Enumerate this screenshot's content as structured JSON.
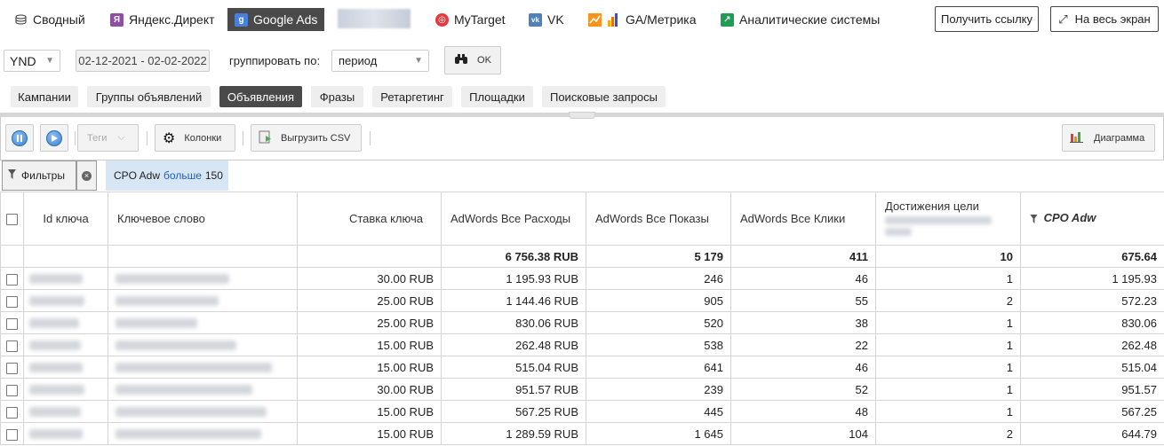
{
  "nav": {
    "items": [
      {
        "label": "Сводный",
        "icon": "coins-icon"
      },
      {
        "label": "Яндекс.Директ",
        "icon": "yandex-icon"
      },
      {
        "label": "Google Ads",
        "icon": "google-icon"
      },
      {
        "label": "MyTarget",
        "icon": "mytarget-icon"
      },
      {
        "label": "VK",
        "icon": "vk-icon"
      },
      {
        "label": "GA/Метрика",
        "icon": "analytics-icon"
      },
      {
        "label": "Аналитические системы",
        "icon": "analytics-systems-icon"
      }
    ],
    "get_link": "Получить ссылку",
    "fullscreen": "На весь экран"
  },
  "filters": {
    "currency": "YND",
    "date_range": "02-12-2021 - 02-02-2022",
    "group_by_label": "группировать по:",
    "group_by_value": "период",
    "ok": "OK"
  },
  "tabs": [
    "Кампании",
    "Группы объявлений",
    "Объявления",
    "Фразы",
    "Ретаргетинг",
    "Площадки",
    "Поисковые запросы"
  ],
  "toolbar": {
    "tags": "Теги",
    "columns": "Колонки",
    "export": "Выгрузить CSV",
    "chart": "Диаграмма"
  },
  "filterbar": {
    "filters_label": "Фильтры",
    "chip_metric": "CPO Adw",
    "chip_op": "больше",
    "chip_value": "150"
  },
  "table": {
    "headers": {
      "id": "Id ключа",
      "keyword": "Ключевое слово",
      "bid": "Ставка ключа",
      "spend": "AdWords Все Расходы",
      "impressions": "AdWords Все Показы",
      "clicks": "AdWords Все Клики",
      "goals": "Достижения цели",
      "cpo": "CPO Adw"
    },
    "totals": {
      "spend": "6 756.38 RUB",
      "impressions": "5 179",
      "clicks": "411",
      "goals": "10",
      "cpo": "675.64"
    },
    "rows": [
      {
        "bid": "30.00 RUB",
        "spend": "1 195.93 RUB",
        "impressions": "246",
        "clicks": "46",
        "goals": "1",
        "cpo": "1 195.93"
      },
      {
        "bid": "25.00 RUB",
        "spend": "1 144.46 RUB",
        "impressions": "905",
        "clicks": "55",
        "goals": "2",
        "cpo": "572.23"
      },
      {
        "bid": "25.00 RUB",
        "spend": "830.06 RUB",
        "impressions": "520",
        "clicks": "38",
        "goals": "1",
        "cpo": "830.06"
      },
      {
        "bid": "15.00 RUB",
        "spend": "262.48 RUB",
        "impressions": "538",
        "clicks": "22",
        "goals": "1",
        "cpo": "262.48"
      },
      {
        "bid": "15.00 RUB",
        "spend": "515.04 RUB",
        "impressions": "641",
        "clicks": "46",
        "goals": "1",
        "cpo": "515.04"
      },
      {
        "bid": "30.00 RUB",
        "spend": "951.57 RUB",
        "impressions": "239",
        "clicks": "52",
        "goals": "1",
        "cpo": "951.57"
      },
      {
        "bid": "15.00 RUB",
        "spend": "567.25 RUB",
        "impressions": "445",
        "clicks": "48",
        "goals": "1",
        "cpo": "567.25"
      },
      {
        "bid": "15.00 RUB",
        "spend": "1 289.59 RUB",
        "impressions": "1 645",
        "clicks": "104",
        "goals": "2",
        "cpo": "644.79"
      }
    ]
  }
}
